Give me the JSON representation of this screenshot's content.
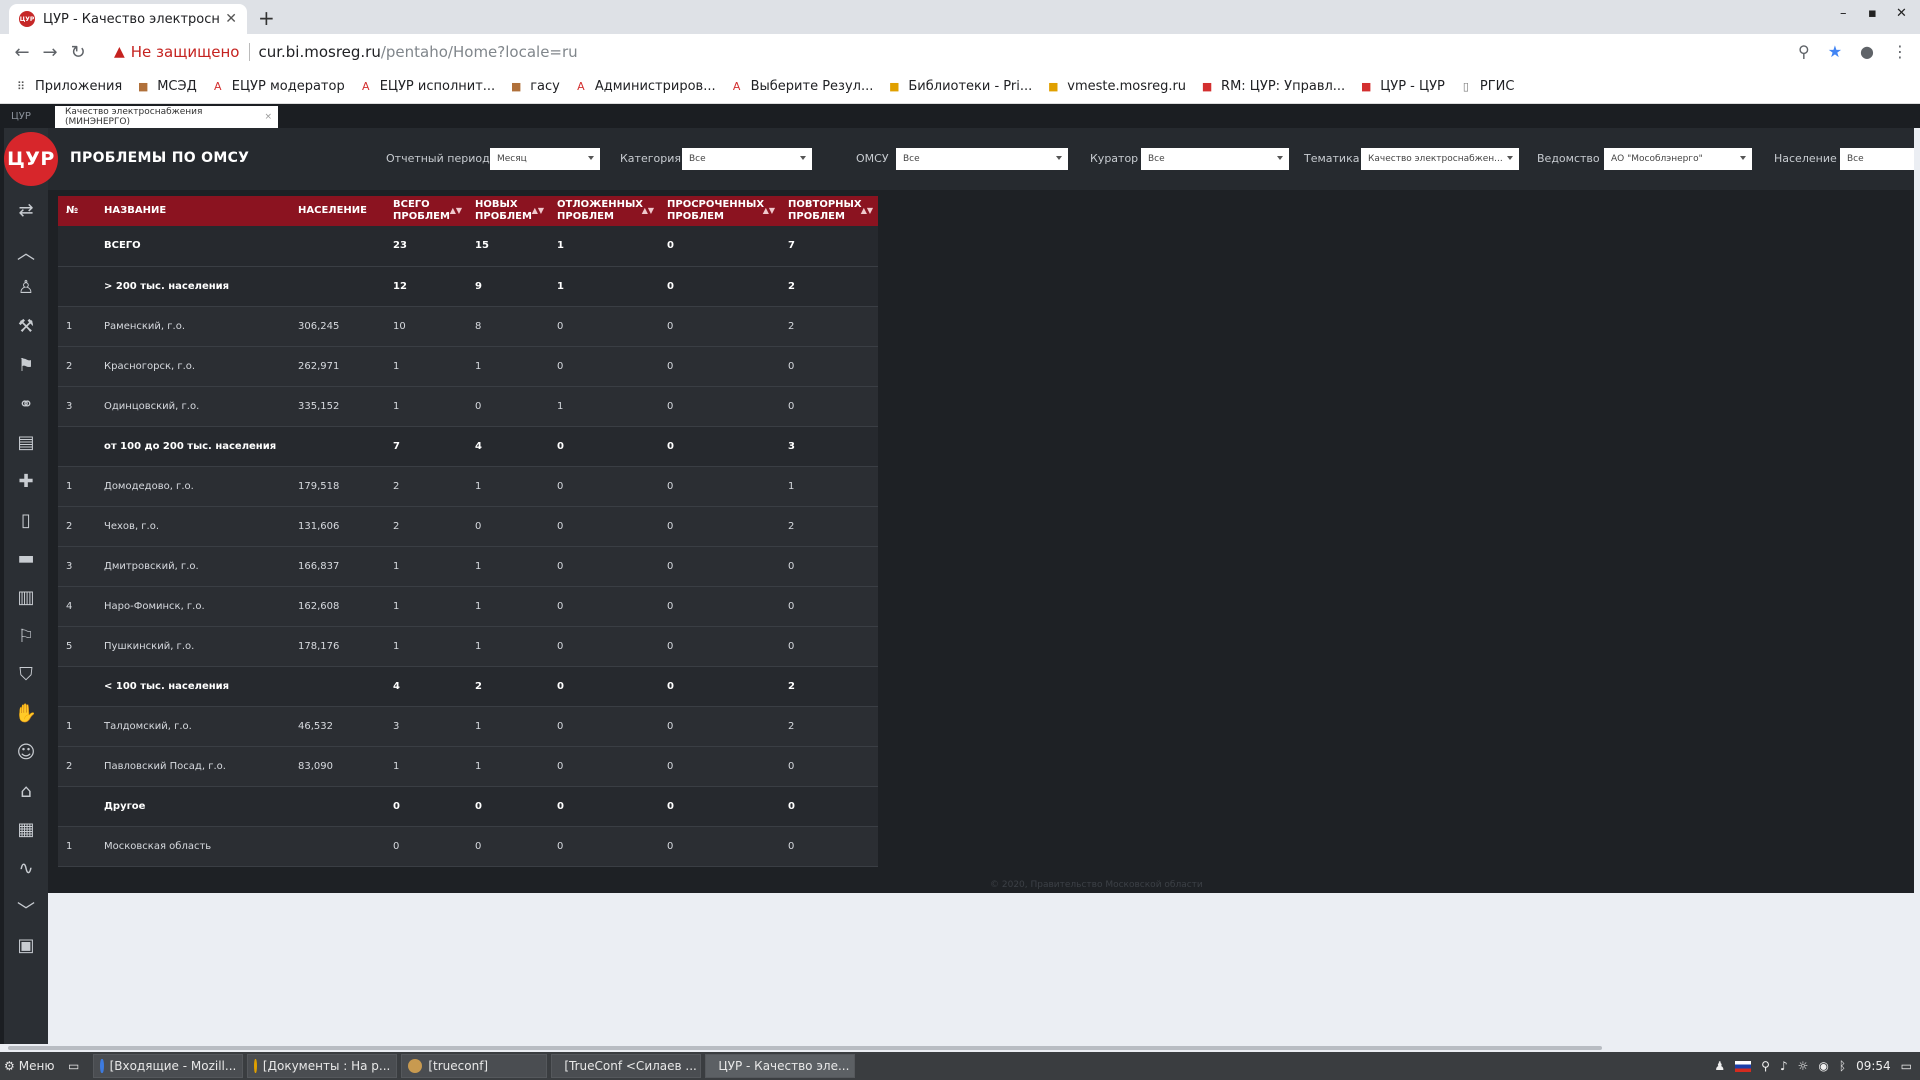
{
  "browser": {
    "tab_title": "ЦУР - Качество электроснаб",
    "favicon_text": "ЦУР",
    "insecure_label": "Не защищено",
    "url_host": "cur.bi.mosreg.ru",
    "url_path": "/pentaho/Home?locale=ru"
  },
  "bookmarks": [
    {
      "label": "Приложения",
      "icon": "apps-grid-icon",
      "color": "#555555"
    },
    {
      "label": "МСЭД",
      "icon": "bookmark-icon",
      "color": "#b0703a"
    },
    {
      "label": "ЕЦУР модератор",
      "icon": "angular-icon",
      "color": "#d32f2f"
    },
    {
      "label": "ЕЦУР исполнит...",
      "icon": "angular-icon",
      "color": "#d32f2f"
    },
    {
      "label": "гасу",
      "icon": "bookmark-icon",
      "color": "#b0703a"
    },
    {
      "label": "Администриров...",
      "icon": "angular-icon",
      "color": "#d32f2f"
    },
    {
      "label": "Выберите Резул...",
      "icon": "angular-icon",
      "color": "#d32f2f"
    },
    {
      "label": "Библиотеки - Pri...",
      "icon": "bookmark-icon",
      "color": "#e0a000"
    },
    {
      "label": "vmeste.mosreg.ru",
      "icon": "bookmark-icon",
      "color": "#e0a000"
    },
    {
      "label": "RM: ЦУР: Управл...",
      "icon": "bookmark-icon",
      "color": "#d32f2f"
    },
    {
      "label": "ЦУР - ЦУР",
      "icon": "bookmark-icon",
      "color": "#d32f2f"
    },
    {
      "label": "РГИС",
      "icon": "page-icon",
      "color": "#777777"
    }
  ],
  "pentaho_tabs": {
    "home": "ЦУР",
    "active": "Качество электроснабжения (МИНЭНЕРГО)"
  },
  "app": {
    "logo_text": "ЦУР",
    "title": "ПРОБЛЕМЫ ПО ОМСУ",
    "footer": "© 2020, Правительство Московской области"
  },
  "filters": {
    "period": {
      "label": "Отчетный период",
      "value": "Месяц"
    },
    "category": {
      "label": "Категория",
      "value": "Все"
    },
    "omsu": {
      "label": "ОМСУ",
      "value": "Все"
    },
    "curator": {
      "label": "Куратор",
      "value": "Все"
    },
    "topic": {
      "label": "Тематика",
      "value": "Качество электроснабжен..."
    },
    "agency": {
      "label": "Ведомство",
      "value": "АО \"Мособлэнерго\""
    },
    "population": {
      "label": "Население",
      "value": "Все"
    }
  },
  "table": {
    "headers": {
      "num": "№",
      "name": "НАЗВАНИЕ",
      "population": "НАСЕЛЕНИЕ",
      "total_1": "ВСЕГО",
      "total_2": "ПРОБЛЕМ",
      "new_1": "НОВЫХ",
      "new_2": "ПРОБЛЕМ",
      "postponed_1": "ОТЛОЖЕННЫХ",
      "postponed_2": "ПРОБЛЕМ",
      "overdue_1": "ПРОСРОЧЕННЫХ",
      "overdue_2": "ПРОБЛЕМ",
      "repeat_1": "ПОВТОРНЫХ",
      "repeat_2": "ПРОБЛЕМ"
    },
    "rows": [
      {
        "num": "",
        "name": "ВСЕГО",
        "population": "",
        "total": "23",
        "new": "15",
        "postponed": "1",
        "overdue": "0",
        "repeat": "7",
        "group": true
      },
      {
        "num": "",
        "name": "> 200 тыс. населения",
        "population": "",
        "total": "12",
        "new": "9",
        "postponed": "1",
        "overdue": "0",
        "repeat": "2",
        "group": true
      },
      {
        "num": "1",
        "name": "Раменский, г.о.",
        "population": "306,245",
        "total": "10",
        "new": "8",
        "postponed": "0",
        "overdue": "0",
        "repeat": "2",
        "group": false
      },
      {
        "num": "2",
        "name": "Красногорск, г.о.",
        "population": "262,971",
        "total": "1",
        "new": "1",
        "postponed": "0",
        "overdue": "0",
        "repeat": "0",
        "group": false
      },
      {
        "num": "3",
        "name": "Одинцовский, г.о.",
        "population": "335,152",
        "total": "1",
        "new": "0",
        "postponed": "1",
        "overdue": "0",
        "repeat": "0",
        "group": false
      },
      {
        "num": "",
        "name": "от 100 до 200 тыс. населения",
        "population": "",
        "total": "7",
        "new": "4",
        "postponed": "0",
        "overdue": "0",
        "repeat": "3",
        "group": true
      },
      {
        "num": "1",
        "name": "Домодедово, г.о.",
        "population": "179,518",
        "total": "2",
        "new": "1",
        "postponed": "0",
        "overdue": "0",
        "repeat": "1",
        "group": false
      },
      {
        "num": "2",
        "name": "Чехов, г.о.",
        "population": "131,606",
        "total": "2",
        "new": "0",
        "postponed": "0",
        "overdue": "0",
        "repeat": "2",
        "group": false
      },
      {
        "num": "3",
        "name": "Дмитровский, г.о.",
        "population": "166,837",
        "total": "1",
        "new": "1",
        "postponed": "0",
        "overdue": "0",
        "repeat": "0",
        "group": false
      },
      {
        "num": "4",
        "name": "Наро-Фоминск, г.о.",
        "population": "162,608",
        "total": "1",
        "new": "1",
        "postponed": "0",
        "overdue": "0",
        "repeat": "0",
        "group": false
      },
      {
        "num": "5",
        "name": "Пушкинский, г.о.",
        "population": "178,176",
        "total": "1",
        "new": "1",
        "postponed": "0",
        "overdue": "0",
        "repeat": "0",
        "group": false
      },
      {
        "num": "",
        "name": "< 100 тыс. населения",
        "population": "",
        "total": "4",
        "new": "2",
        "postponed": "0",
        "overdue": "0",
        "repeat": "2",
        "group": true
      },
      {
        "num": "1",
        "name": "Талдомский, г.о.",
        "population": "46,532",
        "total": "3",
        "new": "1",
        "postponed": "0",
        "overdue": "0",
        "repeat": "2",
        "group": false
      },
      {
        "num": "2",
        "name": "Павловский Посад, г.о.",
        "population": "83,090",
        "total": "1",
        "new": "1",
        "postponed": "0",
        "overdue": "0",
        "repeat": "0",
        "group": false
      },
      {
        "num": "",
        "name": "Другое",
        "population": "",
        "total": "0",
        "new": "0",
        "postponed": "0",
        "overdue": "0",
        "repeat": "0",
        "group": true
      },
      {
        "num": "1",
        "name": "Московская область",
        "population": "",
        "total": "0",
        "new": "0",
        "postponed": "0",
        "overdue": "0",
        "repeat": "0",
        "group": false
      }
    ]
  },
  "sidebar_icons": [
    "swap-icon",
    "chevron-up-icon",
    "person-icon",
    "worker-icon",
    "flag-icon",
    "handshake-icon",
    "document-icon",
    "medical-cross-icon",
    "book-icon",
    "bus-icon",
    "trash-icon",
    "crane-icon",
    "shield-check-icon",
    "hand-icon",
    "teacher-icon",
    "house-icon",
    "building-icon",
    "gesture-icon",
    "chevron-down-icon",
    "save-icon"
  ],
  "taskbar": {
    "menu": "Меню",
    "tasks": [
      {
        "label": "[Входящие - Mozill...",
        "color": "#3d7be0",
        "active": false
      },
      {
        "label": "[Документы : На р...",
        "color": "#e0a000",
        "active": false
      },
      {
        "label": "[trueconf]",
        "color": "#c89a50",
        "active": false
      },
      {
        "label": "[TrueConf <Силаев ...",
        "color": "#3aa0c8",
        "active": false
      },
      {
        "label": "ЦУР - Качество эле...",
        "color": "#e0a000",
        "active": true
      }
    ],
    "time": "09:54"
  }
}
